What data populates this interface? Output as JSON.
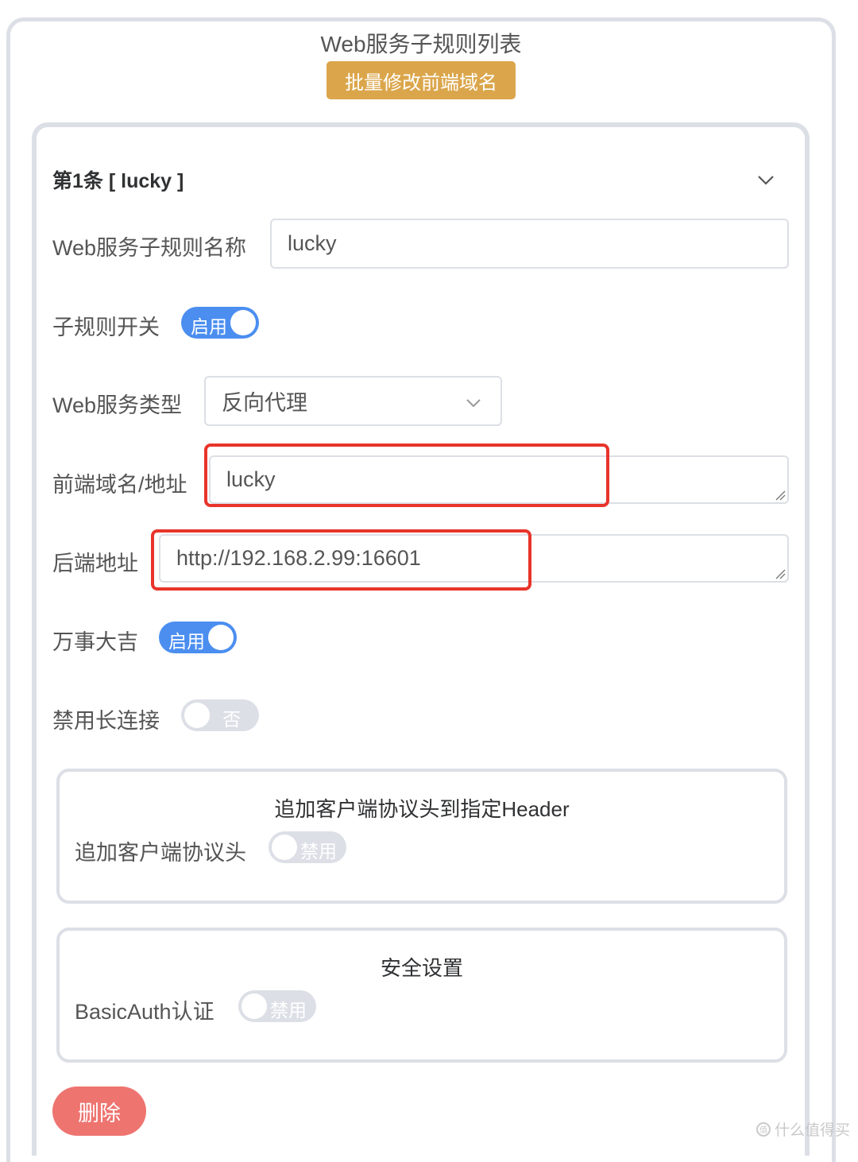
{
  "page": {
    "title": "Web服务子规则列表",
    "batch_button": "批量修改前端域名"
  },
  "rule": {
    "header": "第1条 [ lucky ]",
    "fields": {
      "name_label": "Web服务子规则名称",
      "name_value": "lucky",
      "switch_label": "子规则开关",
      "switch_state": "启用",
      "type_label": "Web服务类型",
      "type_value": "反向代理",
      "frontend_label": "前端域名/地址",
      "frontend_value": "lucky",
      "backend_label": "后端地址",
      "backend_value": "http://192.168.2.99:16601",
      "wanshi_label": "万事大吉",
      "wanshi_state": "启用",
      "keepalive_label": "禁用长连接",
      "keepalive_state": "否"
    },
    "header_section": {
      "title": "追加客户端协议头到指定Header",
      "toggle_label": "追加客户端协议头",
      "toggle_state": "禁用"
    },
    "security_section": {
      "title": "安全设置",
      "toggle_label": "BasicAuth认证",
      "toggle_state": "禁用"
    },
    "delete_button": "删除"
  },
  "watermark": "什么值得买",
  "colors": {
    "accent_blue": "#4b8ef0",
    "batch_button": "#dba64b",
    "delete_button": "#ee7470",
    "highlight_red": "#e8342a"
  }
}
